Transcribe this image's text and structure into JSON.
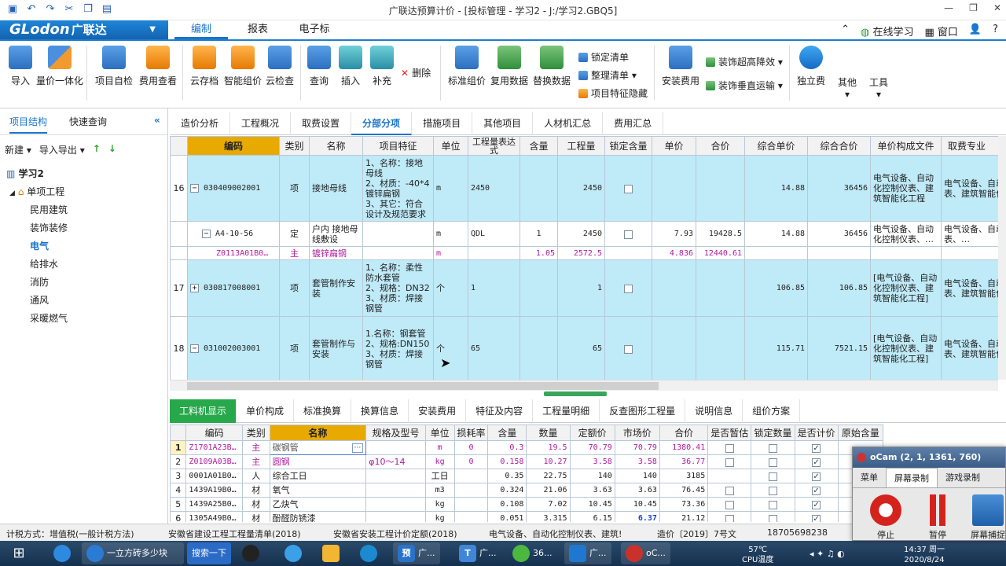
{
  "window": {
    "title": "广联达预算计价 - [投标管理 - 学习2 - J:/学习2.GBQ5]",
    "controls": [
      "—",
      "❐",
      "✕"
    ]
  },
  "menu": {
    "logo": "GLodon",
    "logo_cn": "广联达",
    "tabs": [
      "编制",
      "报表",
      "电子标"
    ],
    "right": [
      "在线学习",
      "窗口",
      "?"
    ]
  },
  "ribbon": {
    "big_buttons": [
      "导入",
      "量价一体化",
      "项目自检",
      "费用查看",
      "云存档",
      "智能组价",
      "云检查",
      "查询",
      "插入",
      "补充",
      "标准组价",
      "复用数据",
      "替换数据",
      "安装费用",
      "独立费",
      "其他",
      "工具"
    ],
    "small_buttons": [
      "删除",
      "锁定清单",
      "整理清单",
      "项目特征隐藏",
      "装饰超高降效",
      "装饰垂直运输"
    ]
  },
  "left_pane": {
    "tabs": [
      "项目结构",
      "快速查询"
    ],
    "tools": [
      "新建",
      "导入导出"
    ],
    "project": "学习2",
    "node": "单项工程",
    "items": [
      "民用建筑",
      "装饰装修",
      "电气",
      "给排水",
      "消防",
      "通风",
      "采暖燃气"
    ],
    "selected": "电气"
  },
  "content_tabs": [
    "造价分析",
    "工程概况",
    "取费设置",
    "分部分项",
    "措施项目",
    "其他项目",
    "人材机汇总",
    "费用汇总"
  ],
  "content_tab_active": "分部分项",
  "grid1": {
    "headers": [
      "",
      "编码",
      "类别",
      "名称",
      "项目特征",
      "单位",
      "工程量表达式",
      "含量",
      "工程量",
      "锁定含量",
      "单价",
      "合价",
      "综合单价",
      "综合合价",
      "单价构成文件",
      "取费专业"
    ],
    "rows": [
      {
        "no": "16",
        "code": "030409002001",
        "cat": "项",
        "name": "接地母线",
        "feat": "1、名称：接地母线\n2、材质：-40*4镀锌扁钢\n3、其它：符合设计及规范要求",
        "unit": "m",
        "expr": "2450",
        "content": "",
        "qty": "2450",
        "locked": false,
        "price": "",
        "total": "",
        "cprice": "14.88",
        "ctotal": "36456",
        "file": "电气设备、自动化控制仪表、建筑智能化工程",
        "spec": "电气设备、自动化控制仪表、建筑智能化工程"
      },
      {
        "no": "",
        "code": "A4-10-56",
        "cat": "定",
        "name": "户内 接地母线敷设",
        "feat": "",
        "unit": "m",
        "expr": "QDL",
        "content": "1",
        "qty": "2450",
        "locked": false,
        "price": "7.93",
        "total": "19428.5",
        "cprice": "14.88",
        "ctotal": "36456",
        "file": "电气设备、自动化控制仪表、…",
        "spec": "电气设备、自动化控制仪表、…"
      },
      {
        "no": "",
        "code": "Z0113A01B0…",
        "cat": "主",
        "name": "镀锌扁钢",
        "feat": "",
        "unit": "m",
        "expr": "",
        "content": "1.05",
        "qty": "2572.5",
        "locked": null,
        "price": "4.836",
        "total": "12440.61",
        "cprice": "",
        "ctotal": "",
        "file": "",
        "spec": ""
      },
      {
        "no": "17",
        "code": "030817008001",
        "cat": "项",
        "name": "套管制作安装",
        "feat": "1、名称：柔性防水套管\n2、规格：DN32\n3、材质：焊接钢管",
        "unit": "个",
        "expr": "1",
        "content": "",
        "qty": "1",
        "locked": false,
        "price": "",
        "total": "",
        "cprice": "106.85",
        "ctotal": "106.85",
        "file": "[电气设备、自动化控制仪表、建筑智能化工程]",
        "spec": "电气设备、自动化控制仪表、建筑智能化工程"
      },
      {
        "no": "18",
        "code": "031002003001",
        "cat": "项",
        "name": "套管制作与安装",
        "feat": "1.名称：钢套管\n2、规格:DN150\n3、材质：焊接钢管",
        "unit": "个",
        "expr": "65",
        "content": "",
        "qty": "65",
        "locked": false,
        "price": "",
        "total": "",
        "cprice": "115.71",
        "ctotal": "7521.15",
        "file": "[电气设备、自动化控制仪表、建筑智能化工程]",
        "spec": "电气设备、自动化控制仪表、建筑智能化工程"
      }
    ]
  },
  "bottom_tabs": [
    "工料机显示",
    "单价构成",
    "标准换算",
    "换算信息",
    "安装费用",
    "特征及内容",
    "工程量明细",
    "反查图形工程量",
    "说明信息",
    "组价方案"
  ],
  "grid2": {
    "headers": [
      "",
      "编码",
      "类别",
      "名称",
      "规格及型号",
      "单位",
      "损耗率",
      "含量",
      "数量",
      "定额价",
      "市场价",
      "合价",
      "是否暂估",
      "锁定数量",
      "是否计价",
      "原始含量"
    ],
    "rows": [
      {
        "no": "1",
        "code": "Z1701A23B…",
        "cat": "主",
        "name": "碳钢管",
        "spec": "",
        "unit": "m",
        "loss": "0",
        "content": "0.3",
        "qty": "19.5",
        "quota": "70.79",
        "market": "70.79",
        "total": "1380.41",
        "est": false,
        "lockq": false,
        "priced": true
      },
      {
        "no": "2",
        "code": "Z0109A03B…",
        "cat": "主",
        "name": "圆钢",
        "spec": "φ10～14",
        "unit": "kg",
        "loss": "0",
        "content": "0.158",
        "qty": "10.27",
        "quota": "3.58",
        "market": "3.58",
        "total": "36.77",
        "est": false,
        "lockq": false,
        "priced": true
      },
      {
        "no": "3",
        "code": "0001A01B0…",
        "cat": "人",
        "name": "综合工日",
        "spec": "",
        "unit": "工日",
        "loss": "",
        "content": "0.35",
        "qty": "22.75",
        "quota": "140",
        "market": "140",
        "total": "3185",
        "est": null,
        "lockq": false,
        "priced": true
      },
      {
        "no": "4",
        "code": "1439A19B0…",
        "cat": "材",
        "name": "氧气",
        "spec": "",
        "unit": "m3",
        "loss": "",
        "content": "0.324",
        "qty": "21.06",
        "quota": "3.63",
        "market": "3.63",
        "total": "76.45",
        "est": false,
        "lockq": false,
        "priced": true
      },
      {
        "no": "5",
        "code": "1439A25B0…",
        "cat": "材",
        "name": "乙炔气",
        "spec": "",
        "unit": "kg",
        "loss": "",
        "content": "0.108",
        "qty": "7.02",
        "quota": "10.45",
        "market": "10.45",
        "total": "73.36",
        "est": false,
        "lockq": false,
        "priced": true
      },
      {
        "no": "6",
        "code": "1305A49B0…",
        "cat": "材",
        "name": "酚醛防锈漆",
        "spec": "",
        "unit": "kg",
        "loss": "",
        "content": "0.051",
        "qty": "3.315",
        "quota": "6.15",
        "market": "6.37",
        "total": "21.12",
        "est": false,
        "lockq": false,
        "priced": true
      }
    ]
  },
  "status": [
    "计税方式：增值税(一般计税方法)",
    "安徽省建设工程工程量清单(2018)",
    "安徽省安装工程计价定额(2018)",
    "电气设备、自动化控制仪表、建筑!",
    "造价〔2019〕7号文",
    "18705698238"
  ],
  "taskbar": {
    "items": [
      "一立方砖多少块",
      "搜索一下",
      "广...",
      "广...",
      "36...",
      "广...",
      "oC..."
    ],
    "temp": "57℃",
    "temp_label": "CPU温度",
    "time": "14:37 周一",
    "date": "2020/8/24"
  },
  "ocam": {
    "title": "oCam (2, 1, 1361, 760)",
    "tabs": [
      "菜单",
      "屏幕录制",
      "游戏录制"
    ],
    "buttons": [
      "停止",
      "暂停",
      "屏幕捕捉"
    ]
  }
}
